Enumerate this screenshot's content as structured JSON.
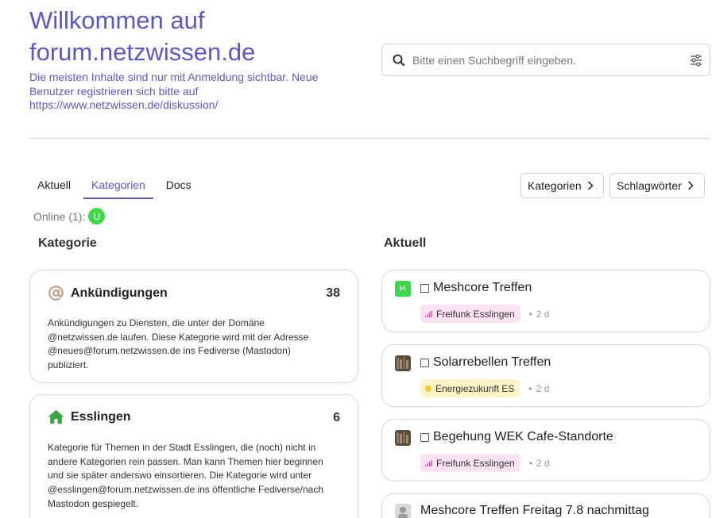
{
  "header": {
    "title_line1": "Willkommen auf",
    "title_line2": "forum.netzwissen.de",
    "desc_line1": "Die meisten Inhalte sind nur mit Anmeldung sichtbar. Neue",
    "desc_line2": "Benutzer registrieren sich bitte auf",
    "desc_line3": "https://www.netzwissen.de/diskussion/"
  },
  "search": {
    "placeholder": "Bitte einen Suchbegriff eingeben.",
    "value": ""
  },
  "tabs": [
    {
      "label": "Aktuell",
      "active": false
    },
    {
      "label": "Kategorien",
      "active": true
    },
    {
      "label": "Docs",
      "active": false
    }
  ],
  "buttons": {
    "categories": "Kategorien",
    "tags": "Schlagwörter"
  },
  "online": {
    "label": "Online (1):",
    "user_initial": "U"
  },
  "columns": {
    "left": "Kategorie",
    "right": "Aktuell"
  },
  "categories": [
    {
      "name": "Ankündigungen",
      "icon": "at-icon",
      "icon_color": "#c4a58a",
      "count": "38",
      "desc_lines": [
        "Ankündigungen zu Diensten, die unter der Domäne",
        "@netzwissen.de laufen. Diese Kategorie wird mit der Adresse",
        "@neues@forum.netzwissen.de ins Fediverse (Mastodon)",
        "publiziert."
      ]
    },
    {
      "name": "Esslingen",
      "icon": "home-icon",
      "icon_color": "#3aa542",
      "count": "6",
      "desc_lines": [
        "Kategorie für Themen in der Stadt Esslingen, die (noch) nicht in",
        "andere Kategorien rein passen. Man kann Themen hier beginnen",
        "und sie später anderswo einsortieren. Die Kategorie wird unter",
        "@esslingen@forum.netzwissen.de ins öffentliche Fediverse/nach",
        "Mastodon gespiegelt."
      ]
    }
  ],
  "topics": [
    {
      "title": "Meshcore Treffen",
      "avatar": "H",
      "avatar_color": "#3ed94a",
      "tag": "Freifunk Esslingen",
      "tag_type": "freifunk",
      "age": "2 d"
    },
    {
      "title": "Solarrebellen Treffen",
      "avatar": "photo",
      "tag": "Energiezukunft ES",
      "tag_type": "energie",
      "age": "2 d"
    },
    {
      "title": "Begehung WEK Cafe-Standorte",
      "avatar": "photo",
      "tag": "Freifunk Esslingen",
      "tag_type": "freifunk",
      "age": "2 d"
    },
    {
      "title": "Meshcore Treffen Freitag 7.8 nachmittag",
      "avatar": "photo-gray"
    }
  ],
  "colors": {
    "accent": "#5d58c4",
    "online_green": "#3ed94a"
  }
}
